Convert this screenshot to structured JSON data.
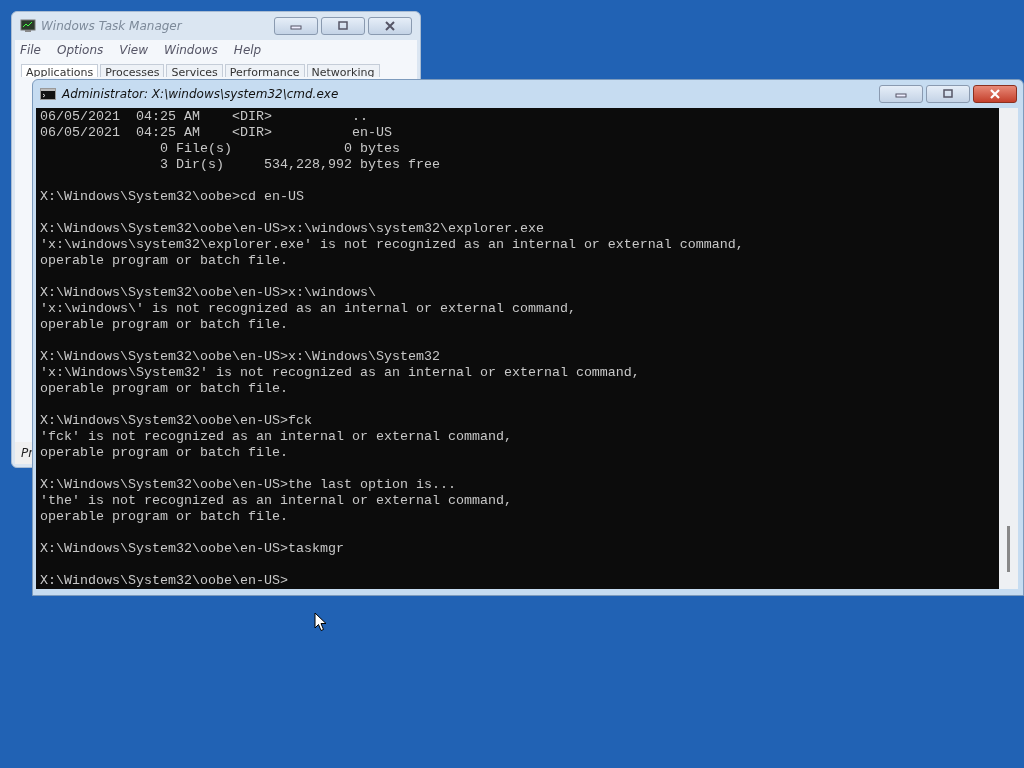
{
  "task_manager": {
    "title": "Windows Task Manager",
    "menu": [
      "File",
      "Options",
      "View",
      "Windows",
      "Help"
    ],
    "tabs": [
      {
        "label": "Applications",
        "selected": true
      },
      {
        "label": "Processes",
        "selected": false
      },
      {
        "label": "Services",
        "selected": false
      },
      {
        "label": "Performance",
        "selected": false
      },
      {
        "label": "Networking",
        "selected": false
      }
    ],
    "status_text": "Pr"
  },
  "console": {
    "title": "Administrator: X:\\windows\\system32\\cmd.exe",
    "blocks": [
      [
        "06/05/2021  04:25 AM    <DIR>          ..",
        "06/05/2021  04:25 AM    <DIR>          en-US",
        "               0 File(s)              0 bytes",
        "               3 Dir(s)     534,228,992 bytes free"
      ],
      [
        "X:\\Windows\\System32\\oobe>cd en-US"
      ],
      [
        "X:\\Windows\\System32\\oobe\\en-US>x:\\windows\\system32\\explorer.exe",
        "'x:\\windows\\system32\\explorer.exe' is not recognized as an internal or external command,",
        "operable program or batch file."
      ],
      [
        "X:\\Windows\\System32\\oobe\\en-US>x:\\windows\\",
        "'x:\\windows\\' is not recognized as an internal or external command,",
        "operable program or batch file."
      ],
      [
        "X:\\Windows\\System32\\oobe\\en-US>x:\\Windows\\System32",
        "'x:\\Windows\\System32' is not recognized as an internal or external command,",
        "operable program or batch file."
      ],
      [
        "X:\\Windows\\System32\\oobe\\en-US>fck",
        "'fck' is not recognized as an internal or external command,",
        "operable program or batch file."
      ],
      [
        "X:\\Windows\\System32\\oobe\\en-US>the last option is...",
        "'the' is not recognized as an internal or external command,",
        "operable program or batch file."
      ],
      [
        "X:\\Windows\\System32\\oobe\\en-US>taskmgr"
      ],
      [
        "X:\\Windows\\System32\\oobe\\en-US>"
      ]
    ]
  }
}
